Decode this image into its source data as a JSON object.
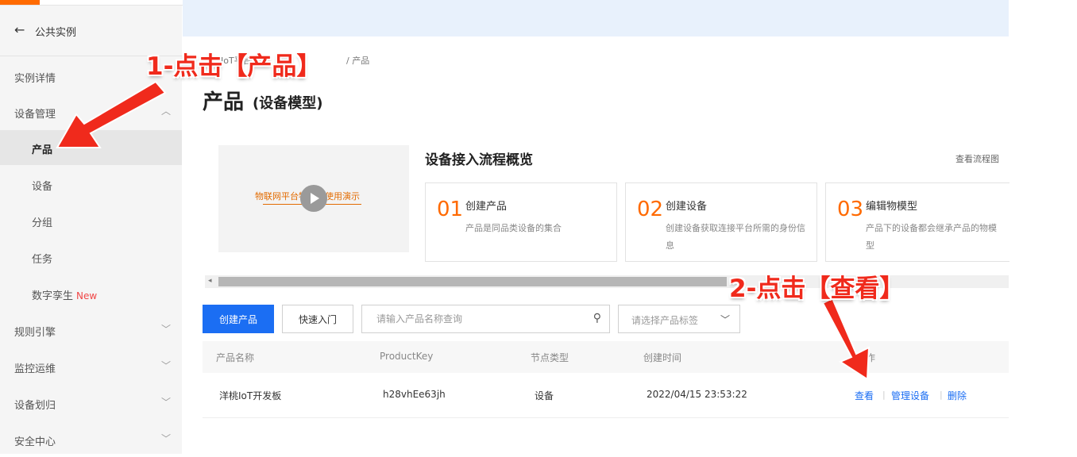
{
  "sidebar": {
    "back_label": "公共实例",
    "items": [
      {
        "label": "实例详情",
        "chevron": ""
      },
      {
        "label": "设备管理",
        "chevron": "up"
      },
      {
        "label": "产品",
        "chevron": ""
      },
      {
        "label": "设备",
        "chevron": ""
      },
      {
        "label": "分组",
        "chevron": ""
      },
      {
        "label": "任务",
        "chevron": ""
      },
      {
        "label": "数字孪生",
        "badge": "New",
        "chevron": ""
      },
      {
        "label": "规则引擎",
        "chevron": "down"
      },
      {
        "label": "监控运维",
        "chevron": "down"
      },
      {
        "label": "设备划归",
        "chevron": "down"
      },
      {
        "label": "安全中心",
        "chevron": "down"
      }
    ]
  },
  "breadcrumb": {
    "partial": "IoT平台",
    "current": "产品"
  },
  "page": {
    "title": "产品",
    "subtitle": "(设备模型)"
  },
  "flow": {
    "title": "设备接入流程概览",
    "link": "查看流程图",
    "video_text": "物联网平台物模型使用演示",
    "steps": [
      {
        "num": "01",
        "title": "创建产品",
        "desc": "产品是同品类设备的集合"
      },
      {
        "num": "02",
        "title": "创建设备",
        "desc": "创建设备获取连接平台所需的身份信息"
      },
      {
        "num": "03",
        "title": "编辑物模型",
        "desc": "产品下的设备都会继承产品的物模型"
      }
    ]
  },
  "toolbar": {
    "create_label": "创建产品",
    "quickstart_label": "快速入门",
    "search_placeholder": "请输入产品名称查询",
    "tag_placeholder": "请选择产品标签"
  },
  "table": {
    "columns": [
      "产品名称",
      "ProductKey",
      "节点类型",
      "创建时间",
      "操作"
    ],
    "rows": [
      {
        "name": "洋桃IoT开发板",
        "key": "h28vhEe63jh",
        "type": "设备",
        "created": "2022/04/15 23:53:22"
      }
    ],
    "actions": [
      "查看",
      "管理设备",
      "删除"
    ]
  },
  "annotations": {
    "a1": "1-点击【产品】",
    "a2": "2-点击【查看】"
  },
  "colors": {
    "accent": "#1b6ef3",
    "orange": "#ff6a00",
    "annotation": "#f02a1c"
  }
}
